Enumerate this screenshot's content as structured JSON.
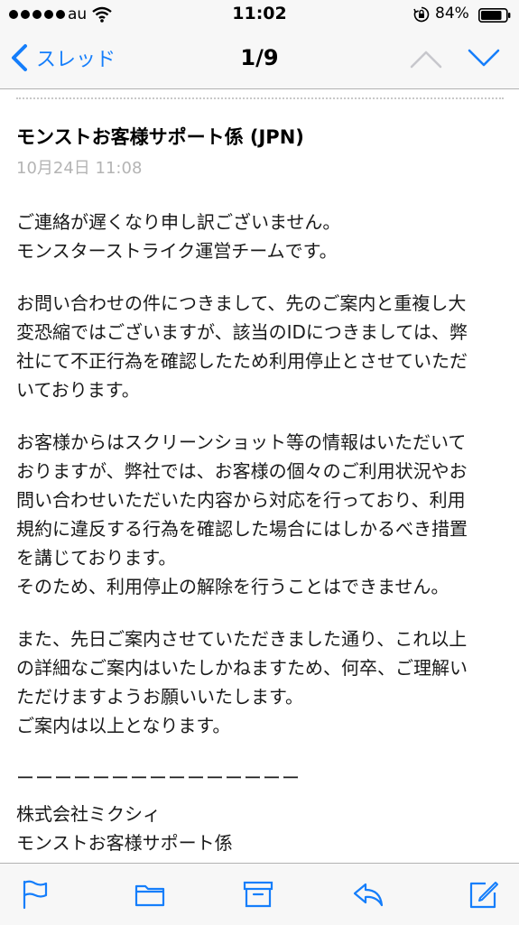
{
  "status_bar": {
    "carrier": "au",
    "time": "11:02",
    "battery_percent": "84%",
    "signal_icon": "signal-dots-icon",
    "wifi_icon": "wifi-icon",
    "lock_icon": "orientation-lock-icon",
    "battery_icon": "battery-icon"
  },
  "nav": {
    "back_label": "スレッド",
    "position": "1/9",
    "accent_color": "#157efb"
  },
  "message": {
    "sender": "モンストお客様サポート係 (JPN)",
    "date": "10月24日 11:08",
    "paragraphs": [
      "ご連絡が遅くなり申し訳ございません。\nモンスターストライク運営チームです。",
      "お問い合わせの件につきまして、先のご案内と重複し大\n変恐縮ではございますが、該当のIDにつきましては、弊\n社にて不正行為を確認したため利用停止とさせていただ\nいております。",
      "お客様からはスクリーンショット等の情報はいただいて\nおりますが、弊社では、お客様の個々のご利用状況やお\n問い合わせいただいた内容から対応を行っており、利用\n規約に違反する行為を確認した場合にはしかるべき措置\nを講じております。\nそのため、利用停止の解除を行うことはできません。",
      "また、先日ご案内させていただきました通り、これ以上\nの詳細なご案内はいたしかねますため、何卒、ご理解い\nただけますようお願いいたします。\nご案内は以上となります。"
    ],
    "signature_rule": "ーーーーーーーーーーーーーーー",
    "signature_company": "株式会社ミクシィ",
    "signature_team": "モンストお客様サポート係"
  },
  "toolbar": {
    "icons": [
      "flag-icon",
      "folder-icon",
      "archive-icon",
      "reply-icon",
      "compose-icon"
    ]
  }
}
